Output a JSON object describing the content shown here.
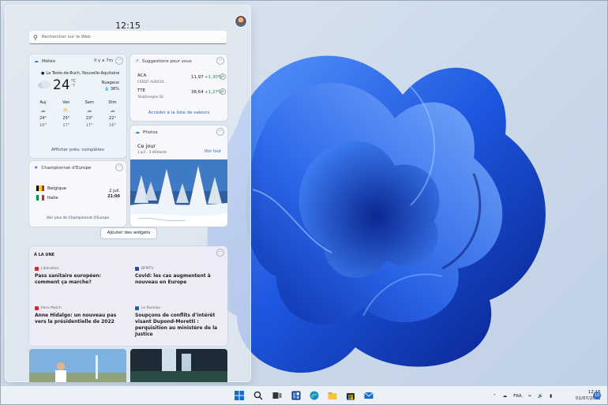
{
  "colors": {
    "accent": "#2b6fd6",
    "stock_positive": "#1a8a3a",
    "bloom_dark": "#0a2fa8",
    "bloom_light": "#4d8cf5"
  },
  "board": {
    "time": "12:15",
    "search_placeholder": "Rechercher sur le Web"
  },
  "weather": {
    "title": "Météo",
    "age": "Il y a 7m",
    "location": "La Teste-de-Buch, Nouvelle-Aquitaine",
    "temp": "24",
    "unit_c": "°C",
    "unit_f": "°F",
    "condition": "Nuageux",
    "humidity": "38%",
    "days": [
      {
        "name": "Auj",
        "icon": "rain-cloud-icon",
        "hi": "24°",
        "lo": "16°"
      },
      {
        "name": "Ven",
        "icon": "partly-sunny-icon",
        "hi": "25°",
        "lo": "17°"
      },
      {
        "name": "Sam",
        "icon": "rain-cloud-icon",
        "hi": "23°",
        "lo": "17°"
      },
      {
        "name": "Dim",
        "icon": "rain-cloud-icon",
        "hi": "22°",
        "lo": "16°"
      }
    ],
    "link": "Afficher prév. complètes"
  },
  "stocks": {
    "title": "Suggestions pour vous",
    "items": [
      {
        "symbol": "ACA",
        "name": "CREDIT AGRICOL...",
        "value": "11,97",
        "change": "+1,30%"
      },
      {
        "symbol": "TTE",
        "name": "TotalEnergies SE",
        "value": "38,64",
        "change": "+1,27%"
      }
    ],
    "link": "Accéder à la liste de valeurs"
  },
  "photos": {
    "title": "Photos",
    "heading": "Ce jour",
    "meta": "1 juil. · 3 éléments",
    "see_all": "Voir tout"
  },
  "euro": {
    "title": "Championnat d'Europe",
    "team1": "Belgique",
    "team2": "Italie",
    "date": "2 juil.",
    "time": "21:00",
    "link": "Voir plus de Championnat d'Europe"
  },
  "add_widgets": "Ajouter des widgets",
  "news": {
    "header": "À LA UNE",
    "items": [
      {
        "source": "Libération",
        "title": "Pass sanitaire européen: comment ça marche?",
        "logo_color": "#d9262e"
      },
      {
        "source": "BFMTV",
        "title": "Covid: les cas augmentent à nouveau en Europe",
        "logo_color": "#1f4aa0"
      },
      {
        "source": "Paris Match",
        "title": "Anne Hidalgo: un nouveau pas vers la présidentielle de 2022",
        "logo_color": "#d9262e"
      },
      {
        "source": "Le Parisien",
        "title": "Soupçons de conflits d'intérêt visant Dupond-Moretti : perquisition au ministère de la Justice",
        "logo_color": "#1f5fb0"
      }
    ]
  },
  "taskbar": {
    "lang": "FRA",
    "time": "12:15",
    "date": "01/07/2021",
    "notifications": "10",
    "icons": [
      "start-icon",
      "search-icon",
      "task-view-icon",
      "widgets-icon",
      "edge-icon",
      "file-explorer-icon",
      "store-icon",
      "mail-icon"
    ]
  }
}
